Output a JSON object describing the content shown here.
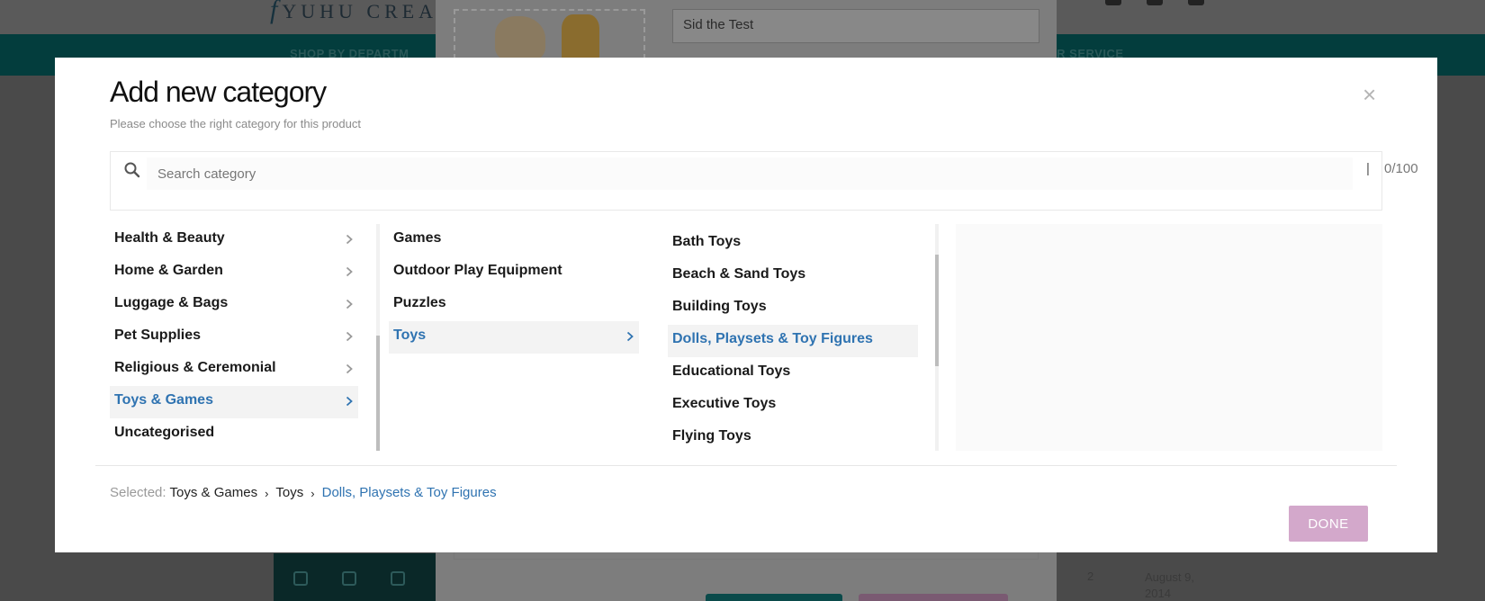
{
  "background": {
    "brand": "YUHU CREATE",
    "brand_initial": "f",
    "nav_left": "SHOP BY DEPARTM",
    "nav_right": "ER SERVICE",
    "product_name_value": "Sid the Test",
    "table": {
      "qty": "2",
      "date": "August 9, 2014"
    }
  },
  "modal": {
    "title": "Add new category",
    "subtitle": "Please choose the right category for this product",
    "close_label": "×",
    "search": {
      "placeholder": "Search category",
      "value": "",
      "separator": "|",
      "counter": "0/100"
    },
    "columns": {
      "level1": [
        {
          "label": "Health & Beauty",
          "has_children": true,
          "active": false
        },
        {
          "label": "Home & Garden",
          "has_children": true,
          "active": false
        },
        {
          "label": "Luggage & Bags",
          "has_children": true,
          "active": false
        },
        {
          "label": "Pet Supplies",
          "has_children": true,
          "active": false
        },
        {
          "label": "Religious & Ceremonial",
          "has_children": true,
          "active": false
        },
        {
          "label": "Toys & Games",
          "has_children": true,
          "active": true
        },
        {
          "label": "Uncategorised",
          "has_children": false,
          "active": false
        }
      ],
      "level2": [
        {
          "label": "Games",
          "has_children": false,
          "active": false
        },
        {
          "label": "Outdoor Play Equipment",
          "has_children": false,
          "active": false
        },
        {
          "label": "Puzzles",
          "has_children": false,
          "active": false
        },
        {
          "label": "Toys",
          "has_children": true,
          "active": true
        }
      ],
      "level3": [
        {
          "label": "Bath Toys",
          "active": false
        },
        {
          "label": "Beach & Sand Toys",
          "active": false
        },
        {
          "label": "Building Toys",
          "active": false
        },
        {
          "label": "Dolls, Playsets & Toy Figures",
          "active": true
        },
        {
          "label": "Educational Toys",
          "active": false
        },
        {
          "label": "Executive Toys",
          "active": false
        },
        {
          "label": "Flying Toys",
          "active": false
        }
      ]
    },
    "selected": {
      "label": "Selected:",
      "path": [
        "Toys & Games",
        "Toys",
        "Dolls, Playsets & Toy Figures"
      ],
      "separator": "›"
    },
    "done_label": "DONE"
  },
  "colors": {
    "accent": "#2f73b1",
    "done_button": "#d3a8cb",
    "overlay": "#4a4a4a",
    "nav_bar": "#033d3d"
  }
}
